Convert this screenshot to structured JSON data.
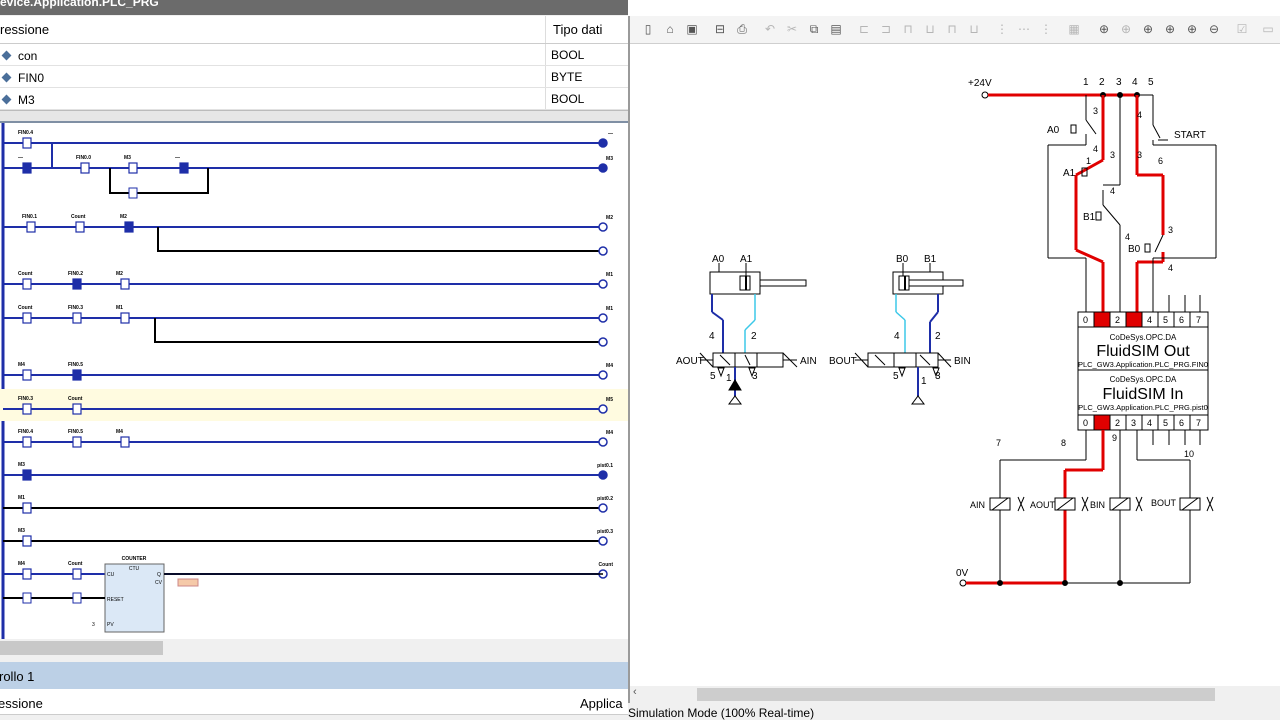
{
  "window_title": "evice.Application.PLC_PRG",
  "var_table": {
    "col_expression": "ressione",
    "col_type": "Tipo dati",
    "rows": [
      {
        "name": "con",
        "type": "BOOL"
      },
      {
        "name": "FIN0",
        "type": "BYTE"
      },
      {
        "name": "M3",
        "type": "BOOL"
      }
    ]
  },
  "ladder": {
    "rungs": [
      {
        "contacts": [
          "FIN0.4"
        ],
        "coil": "—"
      },
      {
        "contacts": [
          "—",
          "FIN0.0",
          "M3",
          "—"
        ],
        "coil": "M3"
      },
      {
        "contacts": [
          "FIN0.1",
          "Count",
          "M2"
        ],
        "coil": "M2"
      },
      {
        "contacts": [
          "Count",
          "FIN0.2",
          "M2"
        ],
        "coil": "M1"
      },
      {
        "contacts": [
          "Count",
          "FIN0.3",
          "M1"
        ],
        "coil": "M1"
      },
      {
        "contacts": [
          "M4",
          "FIN0.5"
        ],
        "coil": "M4"
      },
      {
        "contacts": [
          "FIN0.3",
          "Count"
        ],
        "coil": "M5"
      },
      {
        "contacts": [
          "FIN0.4",
          "FIN0.5",
          "M4"
        ],
        "coil": "M4"
      },
      {
        "contacts": [
          "M3"
        ],
        "coil": "pist0.1"
      },
      {
        "contacts": [
          "M1"
        ],
        "coil": "pist0.2"
      },
      {
        "contacts": [
          "M3"
        ],
        "coil": "pist0.3"
      },
      {
        "contacts": [
          "M4",
          "Count",
          "M3"
        ],
        "coil": "Count"
      }
    ],
    "counter_block": {
      "title": "COUNTER",
      "type": "CTU",
      "pins": [
        "CU",
        "RESET",
        "PV",
        "Q",
        "CV"
      ],
      "pv": "3"
    }
  },
  "bottom_panel": {
    "title": "rollo 1",
    "col_expression": "essione",
    "col_app": "Applica",
    "partial_text": "ollo 1"
  },
  "toolbar_icons": [
    "new-icon",
    "open-icon",
    "save-icon",
    "open-folder-icon",
    "print-icon",
    "undo-icon",
    "cut-icon",
    "copy-icon",
    "paste-icon",
    "align-left-icon",
    "align-center-icon",
    "align-right-icon",
    "distribute-icon",
    "grid-icon",
    "zoom-fit-icon",
    "zoom-icon",
    "zoom-in-icon",
    "zoom-out-icon",
    "check-icon"
  ],
  "fluidsim": {
    "supply_label": "+24V",
    "ground_label": "0V",
    "column_numbers": [
      "1",
      "2",
      "3",
      "4",
      "5",
      "6",
      "7",
      "8",
      "9",
      "10"
    ],
    "switches": [
      "A0",
      "A1",
      "B1",
      "B0",
      "START"
    ],
    "cylinder_a": {
      "sensors": [
        "A0",
        "A1"
      ],
      "valve_left": "AOUT",
      "valve_right": "AIN",
      "ports": [
        "4",
        "2",
        "5",
        "1",
        "3"
      ]
    },
    "cylinder_b": {
      "sensors": [
        "B0",
        "B1"
      ],
      "valve_left": "BOUT",
      "valve_right": "BIN",
      "ports": [
        "4",
        "2",
        "5",
        "1",
        "3"
      ]
    },
    "out_block": {
      "server": "CoDeSys.OPC.DA",
      "title": "FluidSIM Out",
      "item": "PLC_GW3.Application.PLC_PRG.FIN0",
      "bits": [
        "0",
        "1",
        "2",
        "3",
        "4",
        "5",
        "6",
        "7"
      ],
      "active_bits": [
        1,
        3
      ]
    },
    "in_block": {
      "server": "CoDeSys.OPC.DA",
      "title": "FluidSIM In",
      "item": "PLC_GW3.Application.PLC_PRG.pist0",
      "bits": [
        "0",
        "1",
        "2",
        "3",
        "4",
        "5",
        "6",
        "7"
      ],
      "active_bits": [
        1
      ]
    },
    "solenoids": [
      "AIN",
      "AOUT",
      "BIN",
      "BOUT"
    ]
  },
  "status_text": "Simulation Mode (100% Real-time)",
  "colors": {
    "active_wire": "#e00000",
    "ladder_blue": "#1e2ea8",
    "pneumatic_cyan": "#3cc8e8",
    "highlight_row": "#fffbe0"
  }
}
